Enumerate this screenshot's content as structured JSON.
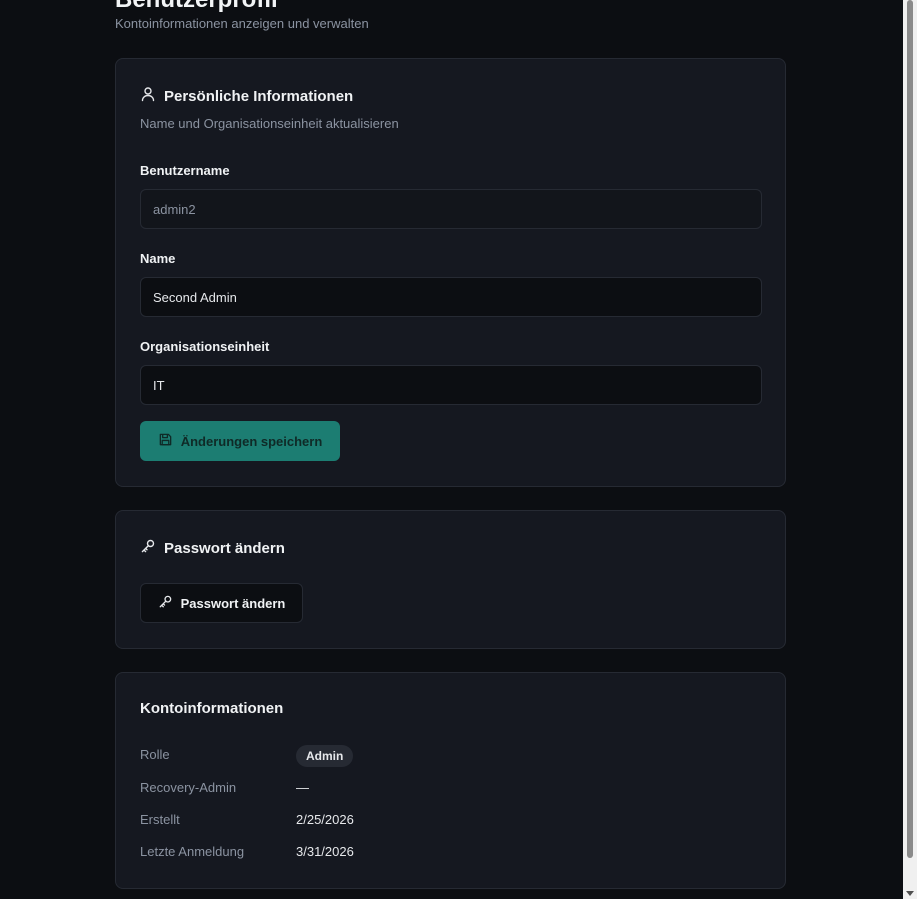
{
  "page": {
    "title": "Benutzerprofil",
    "subtitle": "Kontoinformationen anzeigen und verwalten"
  },
  "personal": {
    "title": "Persönliche Informationen",
    "description": "Name und Organisationseinheit aktualisieren",
    "username_label": "Benutzername",
    "username_value": "admin2",
    "name_label": "Name",
    "name_value": "Second Admin",
    "org_label": "Organisationseinheit",
    "org_value": "IT",
    "save_label": "Änderungen speichern"
  },
  "password": {
    "title": "Passwort ändern",
    "button_label": "Passwort ändern"
  },
  "account": {
    "title": "Kontoinformationen",
    "role_key": "Rolle",
    "role_value": "Admin",
    "recovery_key": "Recovery-Admin",
    "recovery_value": "—",
    "created_key": "Erstellt",
    "created_value": "2/25/2026",
    "last_login_key": "Letzte Anmeldung",
    "last_login_value": "3/31/2026"
  },
  "colors": {
    "background": "#0c0e12",
    "card": "#151820",
    "accent": "#1c7d72",
    "muted_text": "#8b93a1"
  },
  "icons": [
    "user-icon",
    "save-icon",
    "key-icon"
  ]
}
